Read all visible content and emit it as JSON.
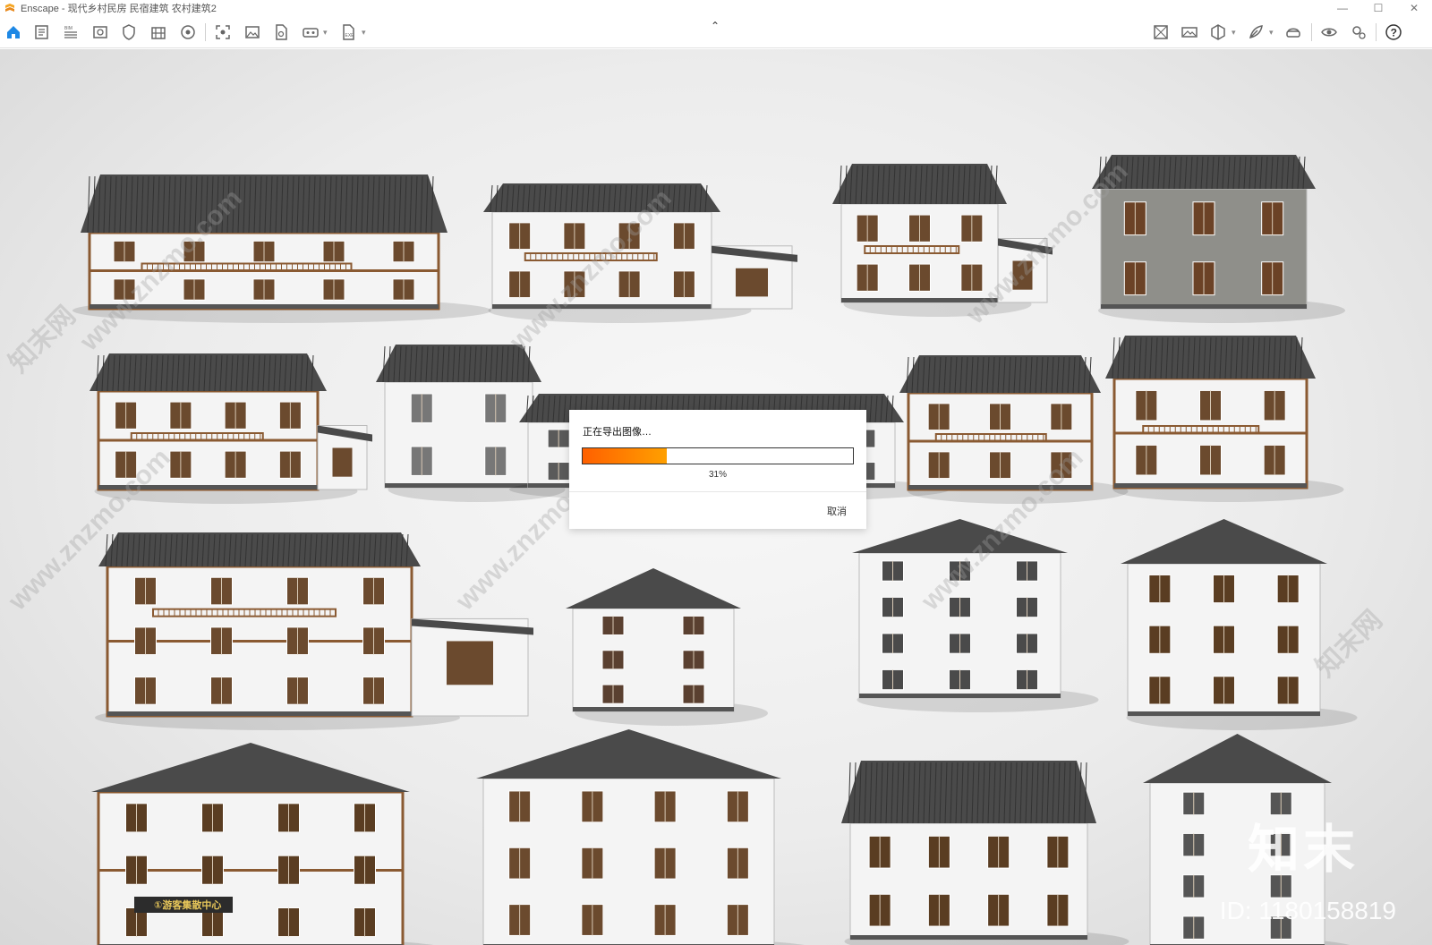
{
  "window": {
    "app_name": "Enscape",
    "title": "Enscape - 现代乡村民房 民宿建筑 农村建筑2",
    "controls": [
      "minimize",
      "maximize",
      "close"
    ]
  },
  "toolbar": {
    "left_icons": [
      "home-icon",
      "notes-icon",
      "bim-icon",
      "view-icon",
      "shield-icon",
      "building-icon",
      "settings-wheel-icon",
      "screenshot-icon",
      "image-icon",
      "document-icon",
      "vr-headset-icon",
      "export-icon"
    ],
    "right_icons": [
      "asset-library-icon",
      "panorama-icon",
      "cube-icon",
      "feather-icon",
      "vr-icon",
      "eye-icon",
      "gear-icon",
      "help-icon"
    ],
    "accent_color": "#1e88e5"
  },
  "dialog": {
    "title": "正在导出图像…",
    "progress": 0.31,
    "progress_text": "31%",
    "cancel_label": "取消"
  },
  "watermarks": {
    "site": "www.znzmo.com",
    "site_alt": "知末网",
    "brand": "知末",
    "id_text": "ID: 1180158819"
  },
  "scene": {
    "sign_text": "①游客集散中心"
  }
}
